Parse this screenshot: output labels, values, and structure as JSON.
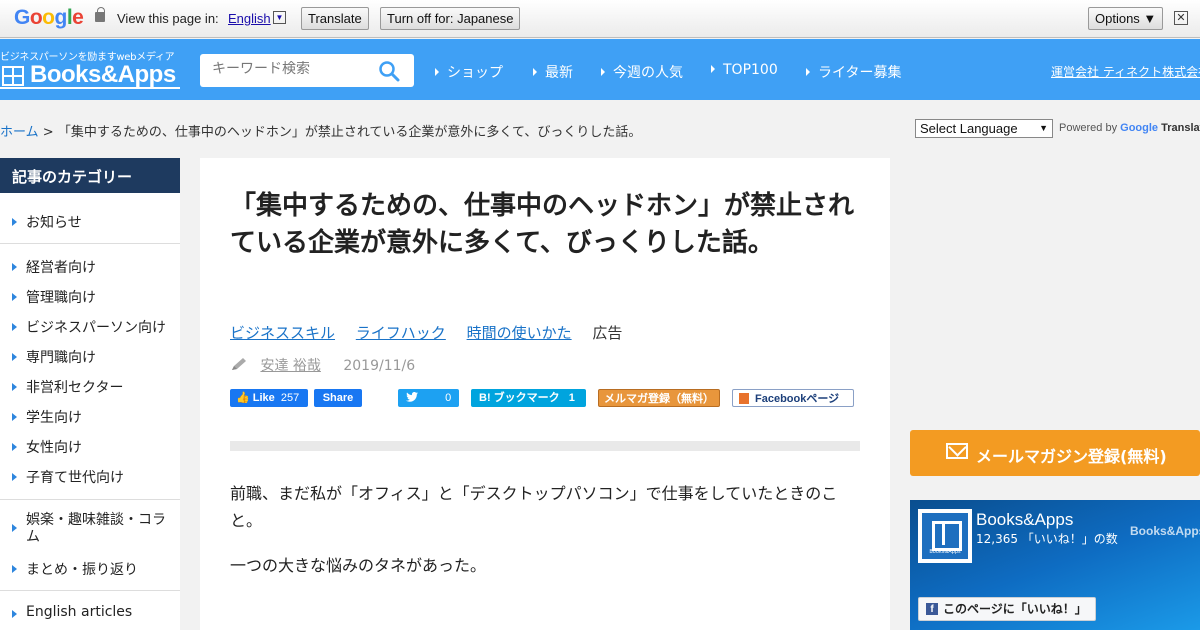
{
  "translate_bar": {
    "logo": "Google",
    "view_text": "View this page in:",
    "language": "English",
    "translate_label": "Translate",
    "turn_off_label": "Turn off for: Japanese",
    "options_label": "Options ▼",
    "close": "✕"
  },
  "header": {
    "tagline": "ビジネスパーソンを励ますwebメディア",
    "logo": "Books&Apps",
    "search_placeholder": "キーワード検索",
    "nav": [
      "ショップ",
      "最新",
      "今週の人気",
      "TOP100",
      "ライター募集"
    ],
    "company_link": "運営会社 ティネクト株式会社"
  },
  "breadcrumb": {
    "home": "ホーム",
    "separator": ">",
    "current": "「集中するための、仕事中のヘッドホン」が禁止されている企業が意外に多くて、びっくりした話。"
  },
  "language_widget": {
    "select_label": "Select Language",
    "powered_by": "Powered by",
    "google": "Google",
    "translate": "Translate"
  },
  "sidebar": {
    "title": "記事のカテゴリー",
    "groups": [
      [
        "お知らせ"
      ],
      [
        "経営者向け",
        "管理職向け",
        "ビジネスパーソン向け",
        "専門職向け",
        "非営利セクター",
        "学生向け",
        "女性向け",
        "子育て世代向け"
      ],
      [
        "娯楽・趣味雑談・コラム",
        "まとめ・振り返り"
      ],
      [
        "English articles"
      ]
    ]
  },
  "article": {
    "title": "「集中するための、仕事中のヘッドホン」が禁止されている企業が意外に多くて、びっくりした話。",
    "tags": [
      "ビジネススキル",
      "ライフハック",
      "時間の使いかた"
    ],
    "ad_label": "広告",
    "author": "安達 裕哉",
    "date": "2019/11/6",
    "share": {
      "fb_like": "Like",
      "fb_like_count": "257",
      "fb_share": "Share",
      "twitter_count": "0",
      "hatena": "B! ブックマーク",
      "hatena_count": "1",
      "mailmag": "メルマガ登録（無料）",
      "fb_page": "Facebookページ"
    },
    "paragraphs": [
      "前職、まだ私が「オフィス」と「デスクトップパソコン」で仕事をしていたときのこと。",
      "一つの大きな悩みのタネがあった。"
    ]
  },
  "right": {
    "mail_button": "メールマガジン登録(無料)",
    "fb_widget": {
      "name": "Books&Apps",
      "count": "12,365 「いいね！」の数",
      "watermark": "Books&Apps",
      "logo_sub": "Books&Apps",
      "like_button": "このページに「いいね！」"
    }
  },
  "colors": {
    "header_blue": "#3fa0f5",
    "sidebar_title": "#1e3a5f",
    "mail_orange": "#f39b22",
    "link_blue": "#1a73c8"
  }
}
